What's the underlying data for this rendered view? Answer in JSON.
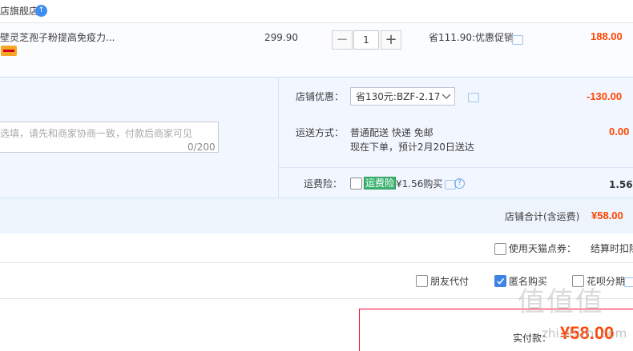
{
  "shop": {
    "name": "店旗舰店",
    "badge": "↑"
  },
  "item": {
    "title": "壁灵芝孢子粉提高免疫力...",
    "unit_price": "299.90",
    "quantity": "1",
    "minus": "−",
    "plus": "+",
    "promo": "省111.90:优惠促销",
    "subtotal": "188.00"
  },
  "shop_coupon": {
    "label": "店铺优惠：",
    "selected": "省130元:BZF-2.17",
    "amount": "-130.00"
  },
  "message": {
    "placeholder": "选填，请先和商家协商一致，付款后商家可见",
    "counter": "0/200"
  },
  "shipping": {
    "label": "运送方式：",
    "method": "普通配送 快递 免邮",
    "note": "现在下单，预计2月20日送达",
    "amount": "0.00"
  },
  "insurance": {
    "label": "运费险：",
    "tag": "运费险",
    "price": "¥1.56购买",
    "amount": "1.56",
    "help": "?"
  },
  "shop_total": {
    "label": "店铺合计(含运费)",
    "amount": "¥58.00"
  },
  "tmall_points": {
    "label": "使用天猫点券：",
    "note": "结算时扣除"
  },
  "options": {
    "friend_pay": "朋友代付",
    "anonymous": "匿名购买",
    "huabei": "花呗分期"
  },
  "payment": {
    "label": "实付款：",
    "amount": "¥58.00"
  },
  "watermark": {
    "brand": "值值值",
    "url": "zhi.zhizhi.com"
  }
}
